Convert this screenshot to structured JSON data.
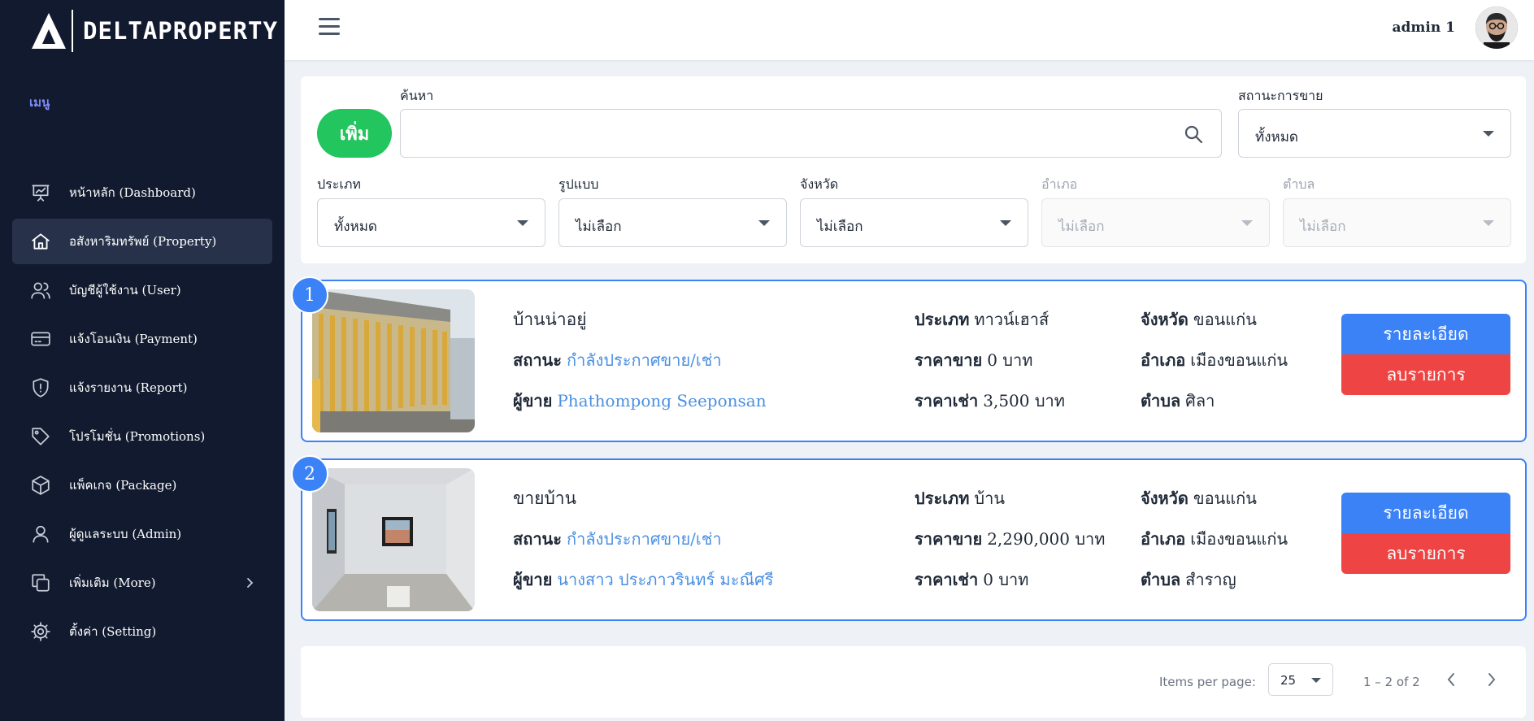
{
  "brand": {
    "name": "DELTAPROPERTY"
  },
  "sidebar": {
    "menu_title": "เมนู",
    "items": [
      {
        "label": "หน้าหลัก (Dashboard)",
        "icon": "presentation-chart-icon"
      },
      {
        "label": "อสังหาริมทรัพย์ (Property)",
        "icon": "home-icon",
        "active": true
      },
      {
        "label": "บัญชีผู้ใช้งาน (User)",
        "icon": "users-icon"
      },
      {
        "label": "แจ้งโอนเงิน (Payment)",
        "icon": "credit-card-icon"
      },
      {
        "label": "แจ้งรายงาน (Report)",
        "icon": "shield-alert-icon"
      },
      {
        "label": "โปรโมชั่น (Promotions)",
        "icon": "tag-icon"
      },
      {
        "label": "แพ็คเกจ (Package)",
        "icon": "package-icon"
      },
      {
        "label": "ผู้ดูแลระบบ (Admin)",
        "icon": "user-icon"
      },
      {
        "label": "เพิ่มเติม (More)",
        "icon": "copy-icon"
      },
      {
        "label": "ตั้งค่า (Setting)",
        "icon": "gear-icon"
      }
    ]
  },
  "header": {
    "user_name": "admin 1"
  },
  "filters": {
    "add_label": "เพิ่ม",
    "search": {
      "label": "ค้นหา",
      "value": ""
    },
    "sale_status": {
      "label": "สถานะการขาย",
      "value": "ทั้งหมด"
    },
    "type": {
      "label": "ประเภท",
      "value": "ทั้งหมด"
    },
    "style": {
      "label": "รูปแบบ",
      "value": "ไม่เลือก"
    },
    "province": {
      "label": "จังหวัด",
      "value": "ไม่เลือก"
    },
    "district": {
      "label": "อำเภอ",
      "value": "ไม่เลือก"
    },
    "subdistrict": {
      "label": "ตำบล",
      "value": "ไม่เลือก"
    }
  },
  "field_labels": {
    "status": "สถานะ",
    "seller": "ผู้ขาย",
    "type": "ประเภท",
    "sale_price": "ราคาขาย",
    "rent_price": "ราคาเช่า",
    "province": "จังหวัด",
    "district": "อำเภอ",
    "subdistrict": "ตำบล",
    "detail_button": "รายละเอียด",
    "delete_button": "ลบรายการ"
  },
  "properties": [
    {
      "index": "1",
      "title": "บ้านน่าอยู่",
      "status": "กำลังประกาศขาย/เช่า",
      "seller": "Phathompong Seeponsan",
      "type": "ทาวน์เฮาส์",
      "sale_price": "0 บาท",
      "rent_price": "3,500 บาท",
      "province": "ขอนแก่น",
      "district": "เมืองขอนแก่น",
      "subdistrict": "ศิลา"
    },
    {
      "index": "2",
      "title": "ขายบ้าน",
      "status": "กำลังประกาศขาย/เช่า",
      "seller": "นางสาว ประภาวรินทร์ มะณีศรี",
      "type": "บ้าน",
      "sale_price": "2,290,000 บาท",
      "rent_price": "0 บาท",
      "province": "ขอนแก่น",
      "district": "เมืองขอนแก่น",
      "subdistrict": "สำราญ"
    }
  ],
  "pagination": {
    "items_per_page_label": "Items per page:",
    "items_per_page": "25",
    "range": "1 – 2 of 2"
  },
  "colors": {
    "sidebar_bg": "#111a2e",
    "active_item_bg": "#27324a",
    "primary": "#3b82f6",
    "danger": "#ef4444",
    "success": "#22c55e",
    "link": "#4a90e2"
  }
}
